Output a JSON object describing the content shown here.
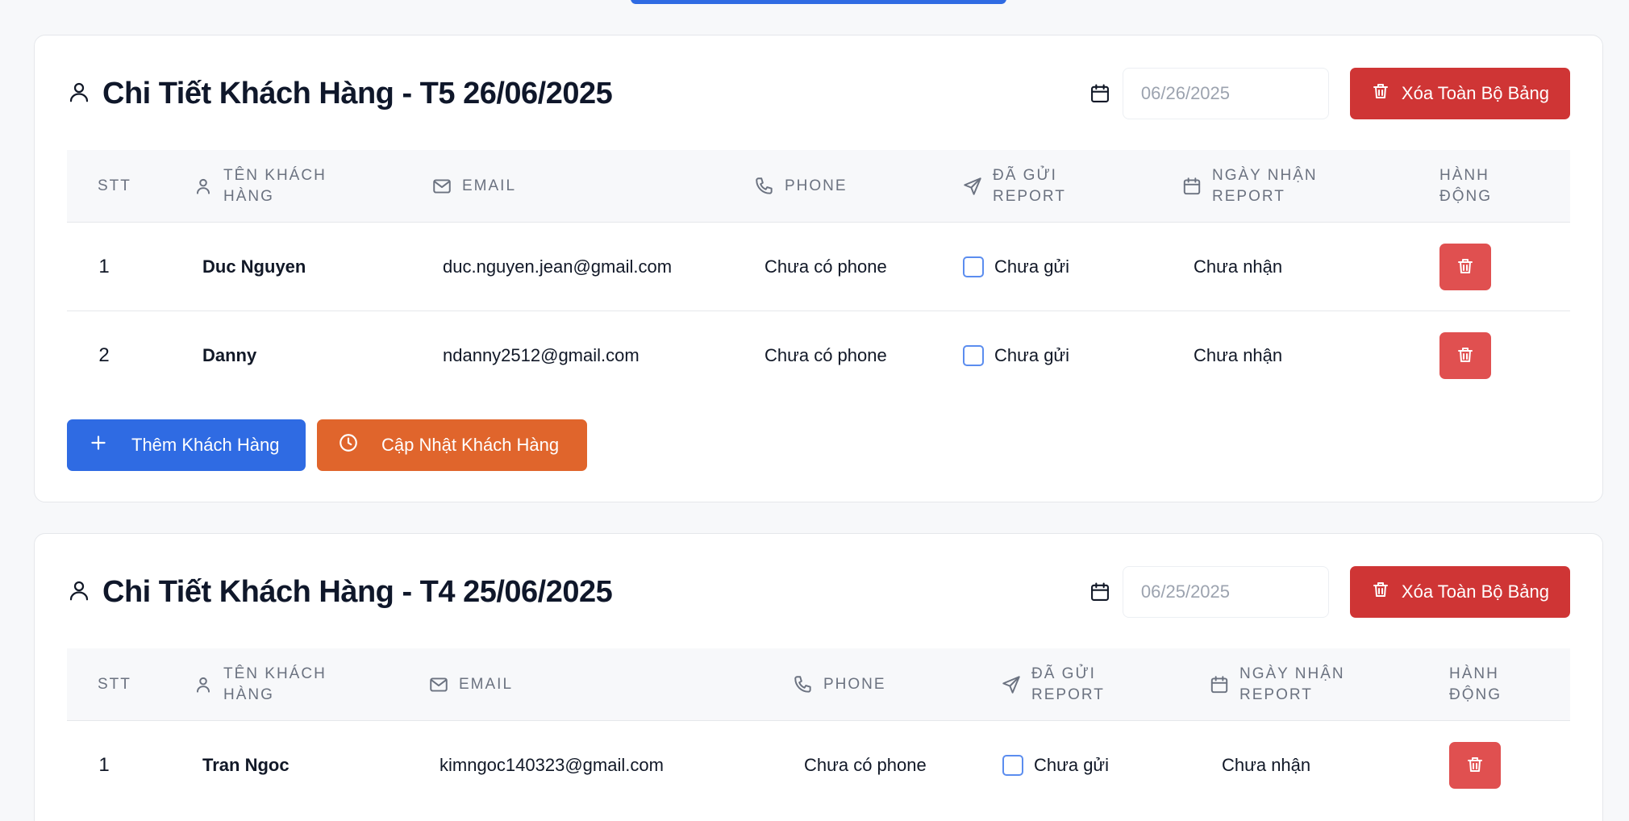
{
  "icons": {
    "user": "user-icon",
    "calendar": "calendar-icon",
    "trash": "trash-icon",
    "mail": "mail-icon",
    "phone": "phone-icon",
    "send": "send-icon",
    "plus": "plus-icon",
    "clock": "clock-icon"
  },
  "colors": {
    "primary": "#2f6be3",
    "danger": "#cf3535",
    "danger_light": "#e05050",
    "orange": "#e0652c",
    "checkbox_border": "#5b8def"
  },
  "headers": {
    "stt": "STT",
    "name": "TÊN KHÁCH\nHÀNG",
    "email": "EMAIL",
    "phone": "PHONE",
    "sent": "ĐÃ GỬI\nREPORT",
    "received": "NGÀY NHẬN\nREPORT",
    "action": "HÀNH\nĐỘNG"
  },
  "cards": [
    {
      "title": "Chi Tiết Khách Hàng - T5 26/06/2025",
      "date_value": "06/26/2025",
      "clear_label": "Xóa Toàn Bộ Bảng",
      "rows": [
        {
          "stt": "1",
          "name": "Duc Nguyen",
          "email": "duc.nguyen.jean@gmail.com",
          "phone": "Chưa có phone",
          "sent_checked": false,
          "sent": "Chưa gửi",
          "received": "Chưa nhận"
        },
        {
          "stt": "2",
          "name": "Danny",
          "email": "ndanny2512@gmail.com",
          "phone": "Chưa có phone",
          "sent_checked": false,
          "sent": "Chưa gửi",
          "received": "Chưa nhận"
        }
      ],
      "add_label": "Thêm Khách Hàng",
      "update_label": "Cập Nhật Khách Hàng"
    },
    {
      "title": "Chi Tiết Khách Hàng - T4 25/06/2025",
      "date_value": "06/25/2025",
      "clear_label": "Xóa Toàn Bộ Bảng",
      "rows": [
        {
          "stt": "1",
          "name": "Tran Ngoc",
          "email": "kimngoc140323@gmail.com",
          "phone": "Chưa có phone",
          "sent_checked": false,
          "sent": "Chưa gửi",
          "received": "Chưa nhận"
        }
      ]
    }
  ]
}
